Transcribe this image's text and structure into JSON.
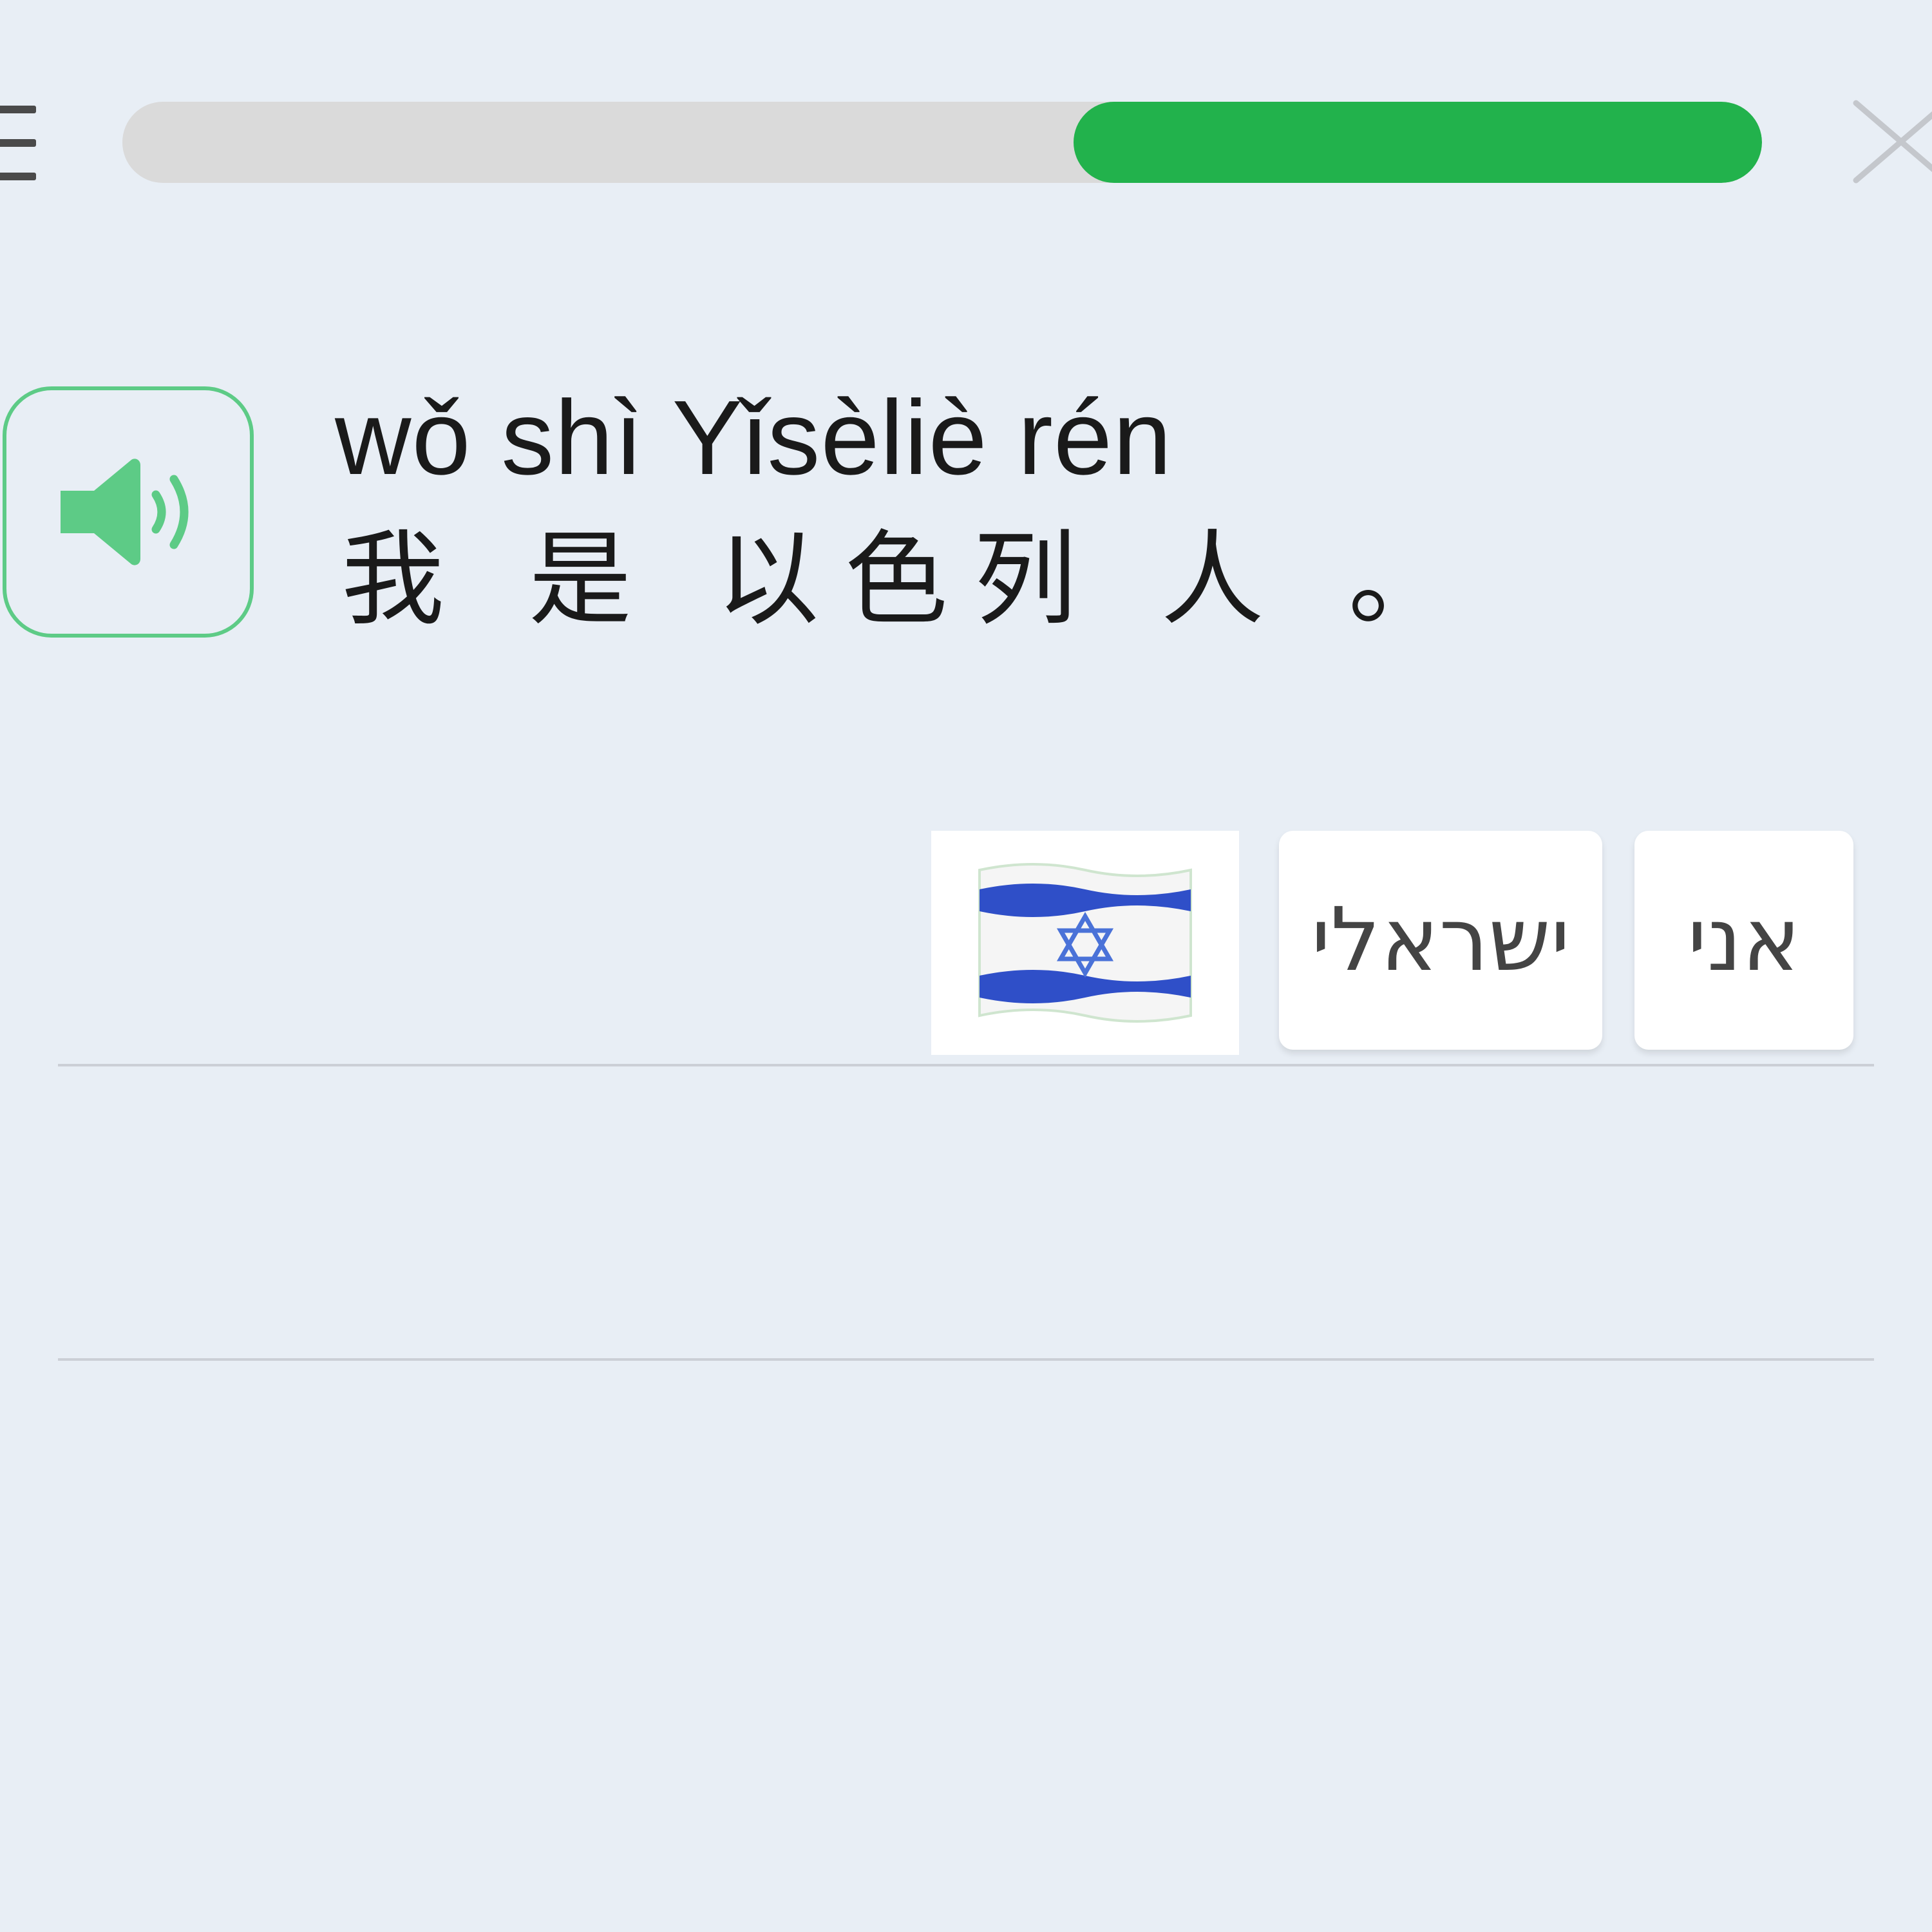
{
  "header": {
    "menu_icon": "hamburger-menu-icon",
    "progress": {
      "value": 0.42,
      "fill_color": "#22b24c",
      "track_color": "#dadada"
    },
    "close_icon": "close-x-icon"
  },
  "prompt": {
    "audio_icon": "speaker-icon",
    "accent_color": "#5dcb86",
    "pinyin": "wǒ shì Yǐsèliè rén",
    "hanzi": "我 是 以色列 人 。"
  },
  "answer": {
    "tokens": [
      {
        "label": "🇮🇱",
        "icon": "israel-flag-icon"
      },
      {
        "label": "ישראלי"
      },
      {
        "label": "אני"
      }
    ]
  }
}
